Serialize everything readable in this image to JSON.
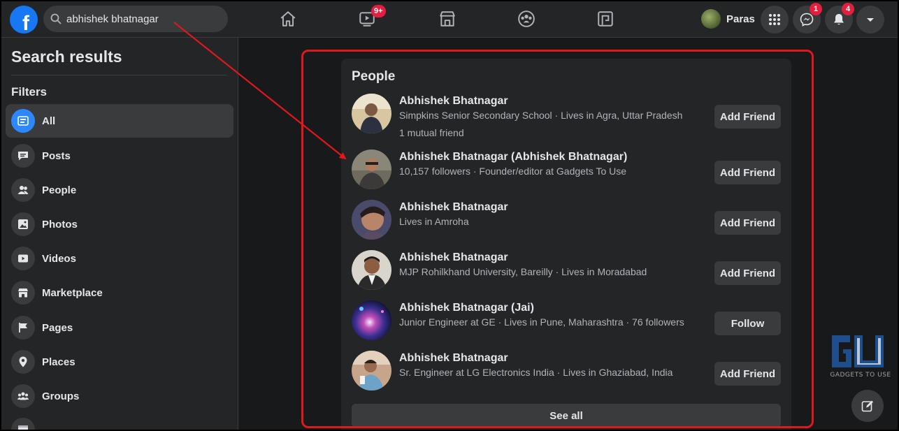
{
  "topbar": {
    "search_value": "abhishek bhatnagar",
    "watch_badge": "9+",
    "profile_name": "Paras",
    "messenger_badge": "1",
    "notifications_badge": "4"
  },
  "sidebar": {
    "title": "Search results",
    "filters_label": "Filters",
    "items": [
      {
        "label": "All",
        "icon": "feed-icon",
        "active": true
      },
      {
        "label": "Posts",
        "icon": "posts-icon"
      },
      {
        "label": "People",
        "icon": "people-icon"
      },
      {
        "label": "Photos",
        "icon": "photos-icon"
      },
      {
        "label": "Videos",
        "icon": "videos-icon"
      },
      {
        "label": "Marketplace",
        "icon": "marketplace-icon"
      },
      {
        "label": "Pages",
        "icon": "flag-icon"
      },
      {
        "label": "Places",
        "icon": "location-pin-icon"
      },
      {
        "label": "Groups",
        "icon": "groups-icon"
      }
    ]
  },
  "people": {
    "title": "People",
    "results": [
      {
        "name": "Abhishek Bhatnagar",
        "sub": "Simpkins Senior Secondary School · Lives in Agra, Uttar Pradesh",
        "sub2": "1 mutual friend",
        "action": "Add Friend"
      },
      {
        "name": "Abhishek Bhatnagar (Abhishek Bhatnagar)",
        "sub": "10,157 followers · Founder/editor at Gadgets To Use",
        "action": "Add Friend"
      },
      {
        "name": "Abhishek Bhatnagar",
        "sub": "Lives in Amroha",
        "action": "Add Friend"
      },
      {
        "name": "Abhishek Bhatnagar",
        "sub": "MJP Rohilkhand University, Bareilly · Lives in Moradabad",
        "action": "Add Friend"
      },
      {
        "name": "Abhishek Bhatnagar (Jai)",
        "sub": "Junior Engineer at GE · Lives in Pune, Maharashtra · 76 followers",
        "action": "Follow"
      },
      {
        "name": "Abhishek Bhatnagar",
        "sub": "Sr. Engineer at LG Electronics India · Lives in Ghaziabad, India",
        "action": "Add Friend"
      }
    ],
    "see_all": "See all"
  },
  "watermark": {
    "text": "GADGETS TO USE"
  },
  "colors": {
    "accent": "#2d88ff",
    "annotation": "#e0181c",
    "badge": "#e41e3f"
  }
}
